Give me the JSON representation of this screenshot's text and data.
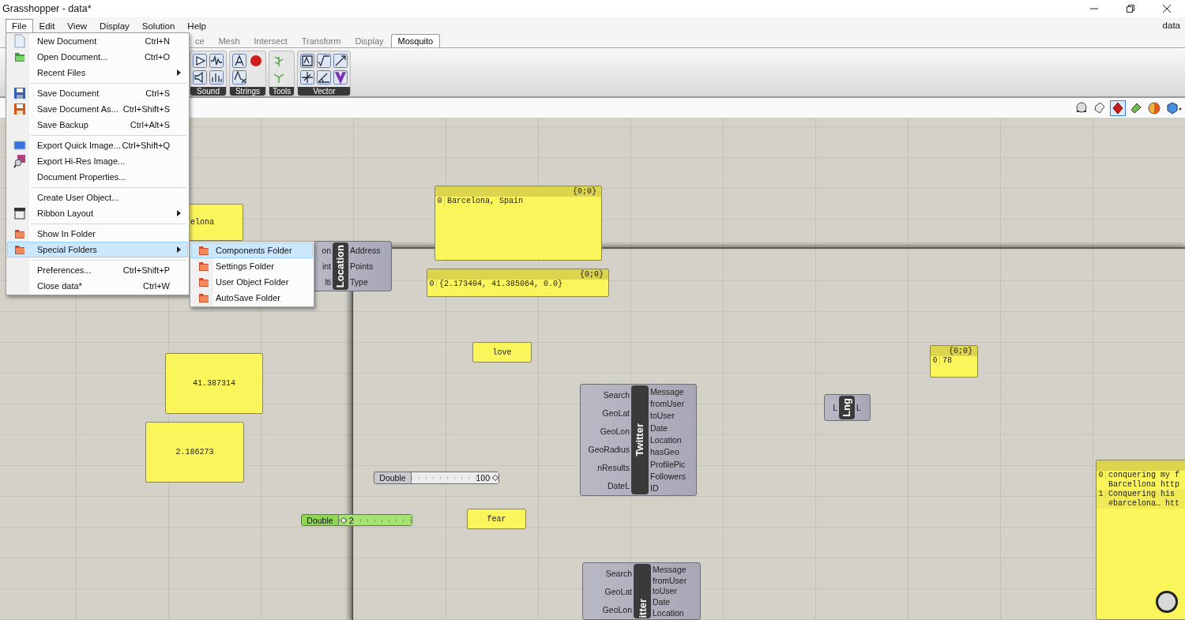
{
  "window": {
    "title": "Grasshopper - data*"
  },
  "menubar": {
    "items": [
      {
        "label": "File",
        "selected": true
      },
      {
        "label": "Edit",
        "selected": false
      },
      {
        "label": "View",
        "selected": false
      },
      {
        "label": "Display",
        "selected": false
      },
      {
        "label": "Solution",
        "selected": false
      },
      {
        "label": "Help",
        "selected": false
      }
    ],
    "document": "data"
  },
  "tabs": [
    {
      "label": "ce",
      "selected": false
    },
    {
      "label": "Mesh",
      "selected": false
    },
    {
      "label": "Intersect",
      "selected": false
    },
    {
      "label": "Transform",
      "selected": false
    },
    {
      "label": "Display",
      "selected": false
    },
    {
      "label": "Mosquito",
      "selected": true
    }
  ],
  "ribbon_groups": [
    {
      "label": "Sound"
    },
    {
      "label": "Strings"
    },
    {
      "label": "Tools"
    },
    {
      "label": "Vector"
    }
  ],
  "canvas_toolbar": [
    {
      "selected": false
    },
    {
      "selected": false
    },
    {
      "selected": true
    },
    {
      "selected": false
    },
    {
      "selected": false
    },
    {
      "selected": false
    }
  ],
  "file_menu": [
    {
      "kind": "item",
      "label": "New Document",
      "shortcut": "Ctrl+N",
      "submenu": false,
      "selected": false
    },
    {
      "kind": "item",
      "label": "Open Document...",
      "shortcut": "Ctrl+O",
      "submenu": false,
      "selected": false
    },
    {
      "kind": "item",
      "label": "Recent Files",
      "submenu": true,
      "selected": false
    },
    {
      "kind": "separator"
    },
    {
      "kind": "item",
      "label": "Save Document",
      "shortcut": "Ctrl+S",
      "submenu": false,
      "selected": false
    },
    {
      "kind": "item",
      "label": "Save Document As...",
      "shortcut": "Ctrl+Shift+S",
      "submenu": false,
      "selected": false
    },
    {
      "kind": "item",
      "label": "Save Backup",
      "shortcut": "Ctrl+Alt+S",
      "submenu": false,
      "selected": false
    },
    {
      "kind": "separator"
    },
    {
      "kind": "item",
      "label": "Export Quick Image...",
      "shortcut": "Ctrl+Shift+Q",
      "submenu": false,
      "selected": false
    },
    {
      "kind": "item",
      "label": "Export Hi-Res Image...",
      "submenu": false,
      "selected": false
    },
    {
      "kind": "item",
      "label": "Document Properties...",
      "submenu": false,
      "selected": false
    },
    {
      "kind": "separator"
    },
    {
      "kind": "item",
      "label": "Create User Object...",
      "submenu": false,
      "selected": false
    },
    {
      "kind": "item",
      "label": "Ribbon Layout",
      "submenu": true,
      "selected": false
    },
    {
      "kind": "separator"
    },
    {
      "kind": "item",
      "label": "Show In Folder",
      "submenu": false,
      "selected": false
    },
    {
      "kind": "item",
      "label": "Special Folders",
      "submenu": true,
      "selected": true
    },
    {
      "kind": "separator"
    },
    {
      "kind": "item",
      "label": "Preferences...",
      "shortcut": "Ctrl+Shift+P",
      "submenu": false,
      "selected": false
    },
    {
      "kind": "item",
      "label": "Close data*",
      "shortcut": "Ctrl+W",
      "submenu": false,
      "selected": false
    }
  ],
  "submenu": [
    {
      "label": "Components Folder",
      "selected": true
    },
    {
      "label": "Settings Folder",
      "selected": false
    },
    {
      "label": "User Object Folder",
      "selected": false
    },
    {
      "label": "AutoSave Folder",
      "selected": false
    }
  ],
  "canvas": {
    "panels": [
      {
        "kind": "plain",
        "text": "elona"
      },
      {
        "kind": "list",
        "header": "{0;0}",
        "rows": [
          {
            "index": "0",
            "text": "Barcelona, Spain"
          }
        ]
      },
      {
        "kind": "list",
        "header": "{0;0}",
        "rows": [
          {
            "index": "0",
            "text": "{2.173404, 41.385064, 0.0}"
          }
        ]
      },
      {
        "kind": "plain",
        "text": "love"
      },
      {
        "kind": "plain",
        "text": "41.387314"
      },
      {
        "kind": "plain",
        "text": "2.186273"
      },
      {
        "kind": "plain",
        "text": "fear"
      },
      {
        "kind": "list",
        "header": "{0;0}",
        "rows": [
          {
            "index": "0",
            "text": "78"
          }
        ]
      },
      {
        "kind": "list",
        "rows": [
          {
            "index": "0",
            "text": "conquering my f\nBarcellona http"
          },
          {
            "index": "1",
            "text": "Conquering his\n#barcelona… htt"
          }
        ]
      }
    ],
    "components": [
      {
        "label": "Location",
        "inputs": [
          "on",
          "int",
          "lti"
        ],
        "outputs": [
          "Address",
          "Points",
          "Type"
        ]
      },
      {
        "label": "Twitter",
        "inputs": [
          "Search",
          "GeoLat",
          "GeoLon",
          "GeoRadius",
          "nResults",
          "DateL"
        ],
        "outputs": [
          "Message",
          "fromUser",
          "toUser",
          "Date",
          "Location",
          "hasGeo",
          "ProfilePic",
          "Followers",
          "ID"
        ]
      },
      {
        "label": "itter",
        "inputs": [
          "Search",
          "GeoLat",
          "GeoLon"
        ],
        "outputs": [
          "Message",
          "fromUser",
          "toUser",
          "Date",
          "Location"
        ]
      },
      {
        "label": "Lng",
        "inputs": [
          "L"
        ],
        "outputs": [
          "L"
        ]
      }
    ],
    "sliders": [
      {
        "label": "Double",
        "value": "100",
        "level": 1.0,
        "selected": false
      },
      {
        "label": "Double",
        "value": "2",
        "level": 0.02,
        "selected": true
      }
    ]
  }
}
